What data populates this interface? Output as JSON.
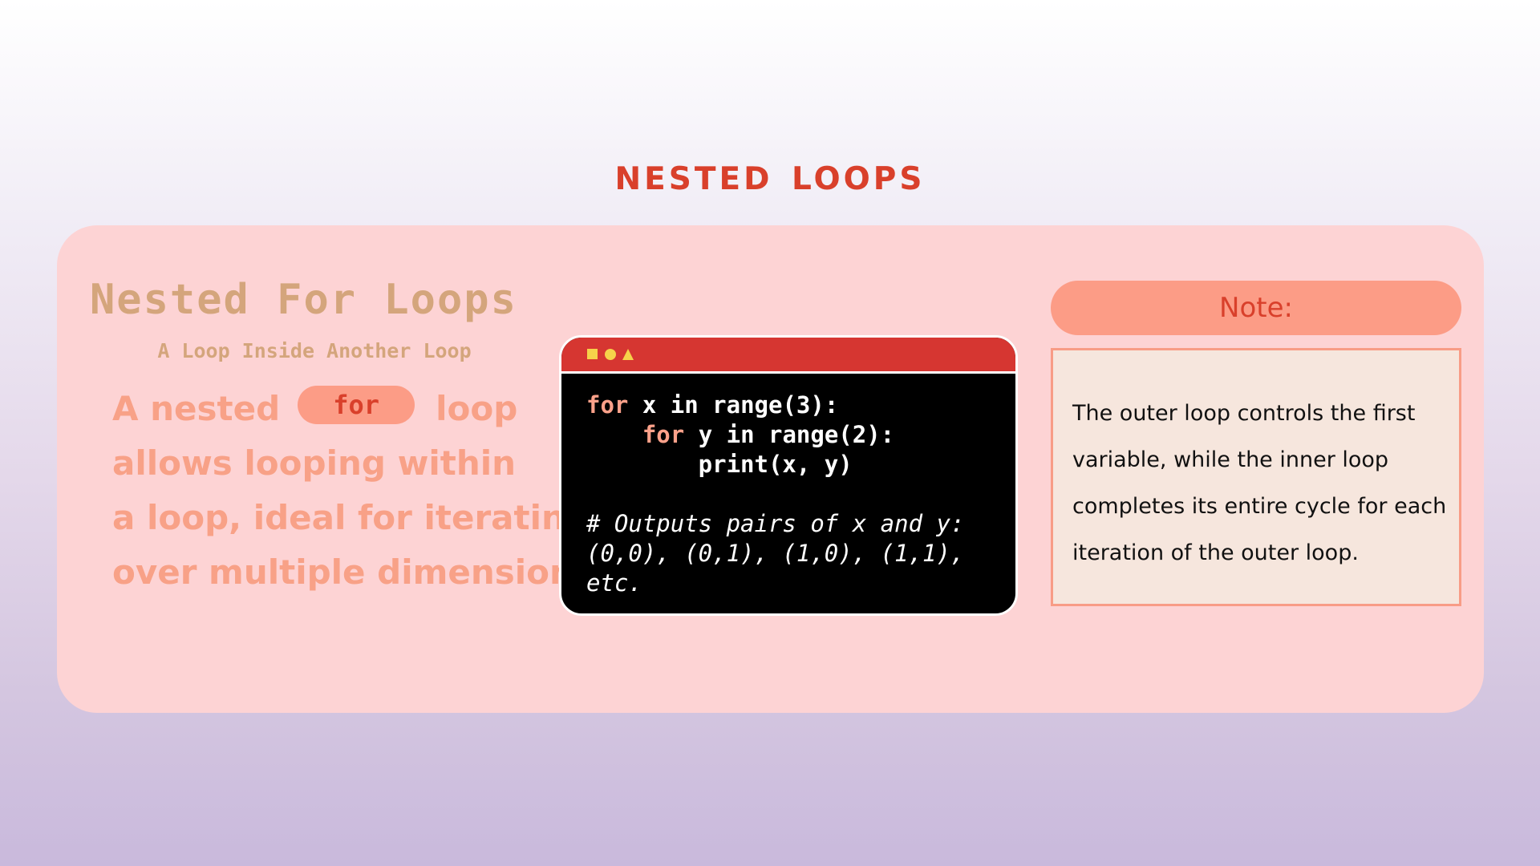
{
  "slide": {
    "title": "Nested Loops"
  },
  "left": {
    "heading": "Nested For Loops",
    "subheading": "A Loop Inside Another Loop",
    "body": {
      "prefix": "A nested",
      "keyword": "for",
      "suffix": "loop",
      "line2": "allows looping within",
      "line3": "a loop, ideal for iterating",
      "line4": "over multiple dimensions."
    }
  },
  "code": {
    "line1": {
      "kw": "for",
      "rest": " x in range(3):"
    },
    "line2": {
      "indent": "    ",
      "kw": "for",
      "rest": " y in range(2):"
    },
    "line3": "        print(x, y)",
    "comment": "# Outputs pairs of x and y: (0,0), (0,1), (1,0), (1,1), etc."
  },
  "note": {
    "label": "Note:",
    "text": "The outer loop controls the first variable, while the inner loop completes its entire cycle for each iteration of the outer loop."
  },
  "colors": {
    "title": "#d9402b",
    "panel": "#fdd3d4",
    "accent": "#fc9c86",
    "code_bar": "#d63631"
  }
}
